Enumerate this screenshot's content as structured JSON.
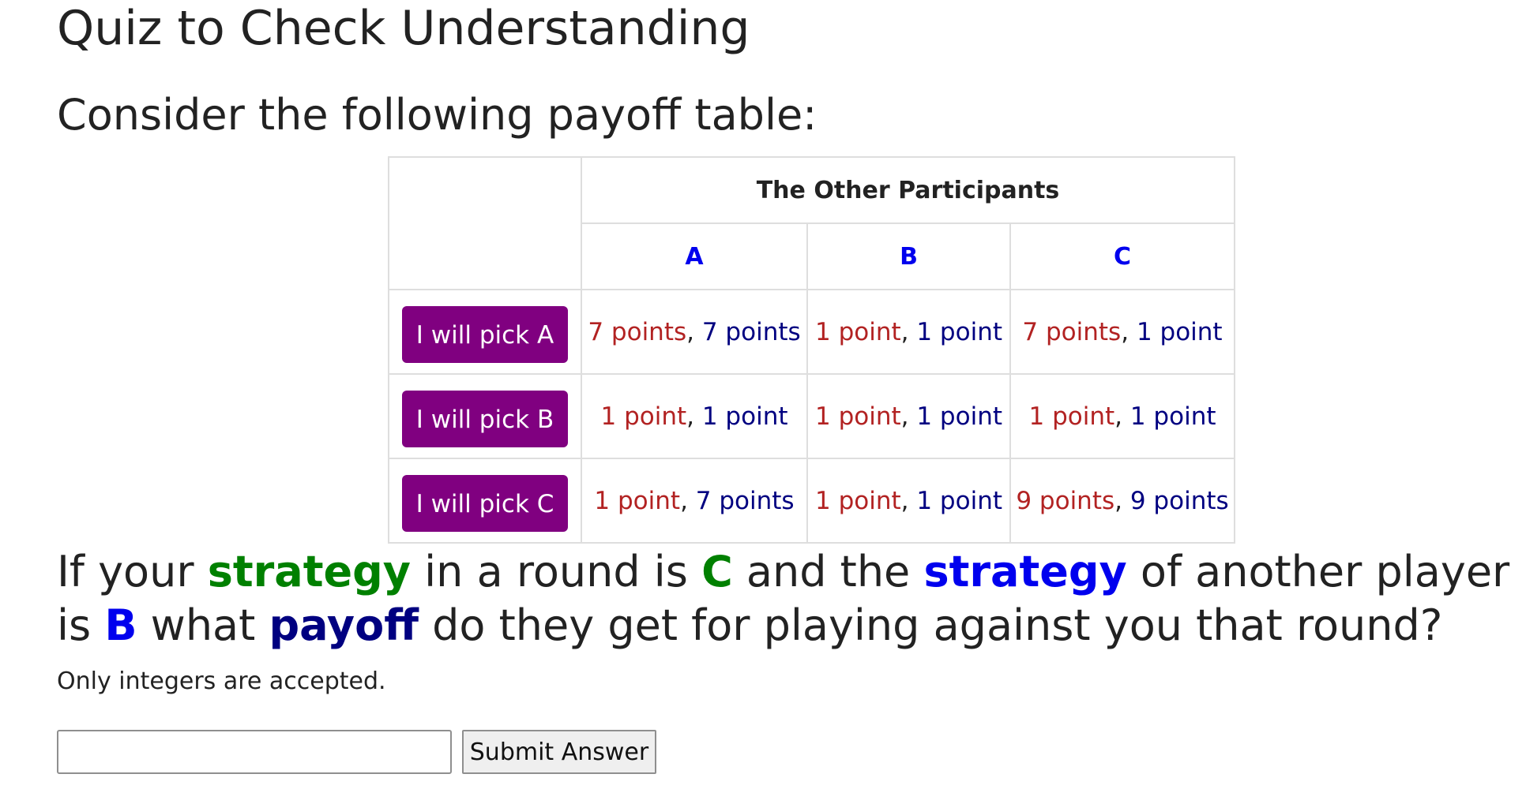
{
  "title": "Quiz to Check Understanding",
  "subtitle": "Consider the following payoff table:",
  "table": {
    "others_header": "The Other Participants",
    "columns": [
      "A",
      "B",
      "C"
    ],
    "separator": ", ",
    "rows": [
      {
        "button": "I will pick A",
        "cells": [
          {
            "me": "7 points",
            "them": "7 points"
          },
          {
            "me": "1 point",
            "them": "1 point"
          },
          {
            "me": "7 points",
            "them": "1 point"
          }
        ]
      },
      {
        "button": "I will pick B",
        "cells": [
          {
            "me": "1 point",
            "them": "1 point"
          },
          {
            "me": "1 point",
            "them": "1 point"
          },
          {
            "me": "1 point",
            "them": "1 point"
          }
        ]
      },
      {
        "button": "I will pick C",
        "cells": [
          {
            "me": "1 point",
            "them": "7 points"
          },
          {
            "me": "1 point",
            "them": "1 point"
          },
          {
            "me": "9 points",
            "them": "9 points"
          }
        ]
      }
    ]
  },
  "question": {
    "part1": "If your ",
    "strategy_1": "strategy",
    "part2": " in a round is ",
    "my_choice": "C",
    "part3": " and the ",
    "strategy_2": "strategy",
    "part4": " of another player is ",
    "their_choice": "B",
    "part5": " what ",
    "payoff_word": "payoff",
    "part6": " do they get for playing against you that round?"
  },
  "hint": "Only integers are accepted.",
  "answer": {
    "value": "",
    "placeholder": ""
  },
  "submit_label": "Submit Answer",
  "colors": {
    "button_purple": "#800080",
    "my_payoff": "#b22222",
    "their_payoff": "#000080",
    "my_strategy": "#008000",
    "their_strategy": "#0000ee"
  }
}
